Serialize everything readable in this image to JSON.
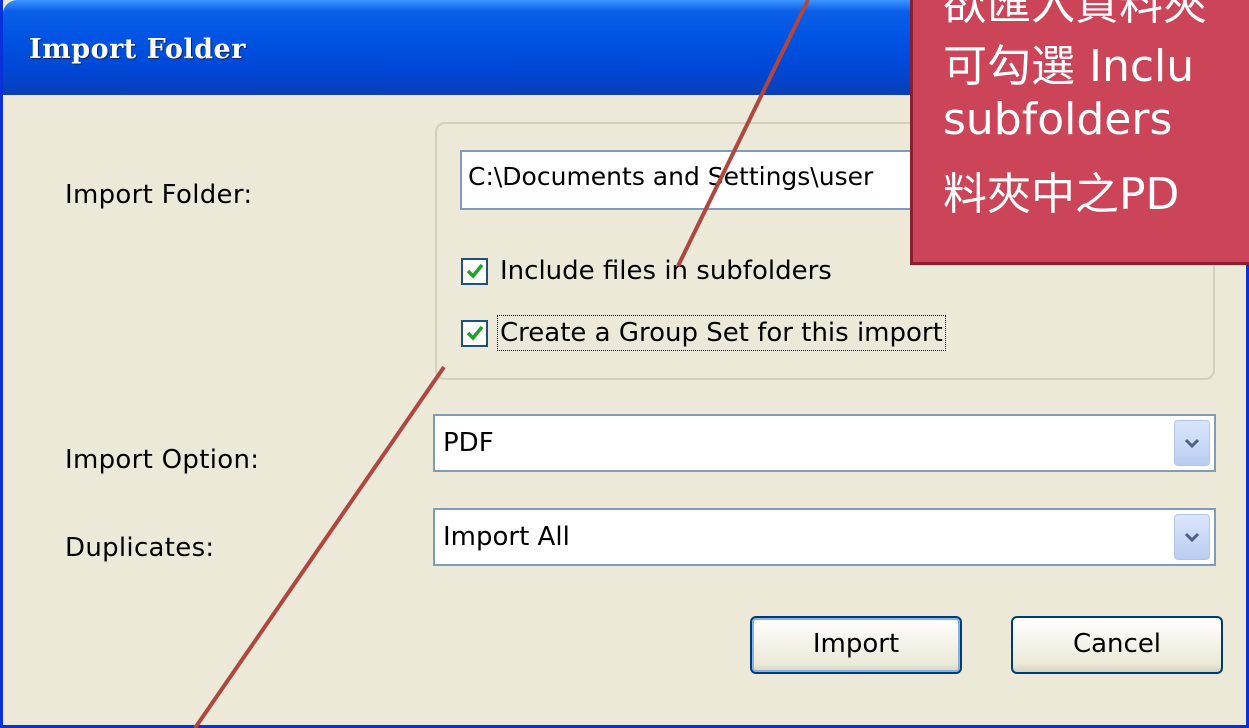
{
  "window": {
    "title": "Import Folder"
  },
  "form": {
    "import_folder_label": "Import Folder:",
    "import_folder_value": "C:\\Documents and Settings\\user",
    "include_subfolders": {
      "label": "Include files in subfolders",
      "checked": true
    },
    "create_group_set": {
      "label": "Create a Group Set for this import",
      "checked": true
    },
    "import_option_label": "Import Option:",
    "import_option_value": "PDF",
    "duplicates_label": "Duplicates:",
    "duplicates_value": "Import All"
  },
  "buttons": {
    "import": "Import",
    "cancel": "Cancel"
  },
  "annotation": {
    "lines": [
      "欲匯入資料夾",
      "可勾選 Inclu",
      "subfolders",
      "料夾中之PD"
    ],
    "color": "#cc4458",
    "arrow_color": "#b0473f"
  }
}
